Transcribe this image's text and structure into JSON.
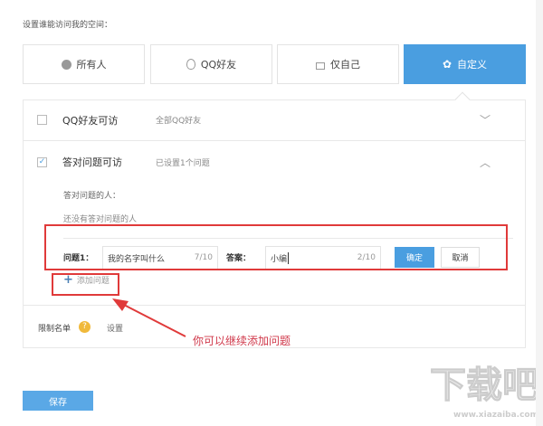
{
  "title": "设置谁能访问我的空间：",
  "tabs": [
    {
      "label": "所有人",
      "icon": "globe-icon"
    },
    {
      "label": "QQ好友",
      "icon": "qq-icon"
    },
    {
      "label": "仅自己",
      "icon": "lock-icon"
    },
    {
      "label": "自定义",
      "icon": "gear-icon",
      "active": true
    }
  ],
  "rows": [
    {
      "label": "QQ好友可访",
      "desc": "全部QQ好友",
      "checked": false
    },
    {
      "label": "答对问题可访",
      "desc": "已设置1个问题",
      "checked": true
    }
  ],
  "answered_label": "答对问题的人：",
  "answered_empty": "还没有答对问题的人",
  "question": {
    "label": "问题1：",
    "value": "我的名字叫什么",
    "count": "7/10",
    "answer_label": "答案：",
    "answer_value": "小编",
    "answer_count": "2/10",
    "confirm": "确定",
    "cancel": "取消"
  },
  "add_question": "添加问题",
  "restrict": {
    "label": "限制名单",
    "help": "?",
    "action": "设置"
  },
  "annotation": "你可以继续添加问题",
  "save": "保存",
  "watermark": "下载吧 www.xiazaiba.com",
  "colors": {
    "accent": "#4a9ee0",
    "annotation": "#e03a3a"
  }
}
